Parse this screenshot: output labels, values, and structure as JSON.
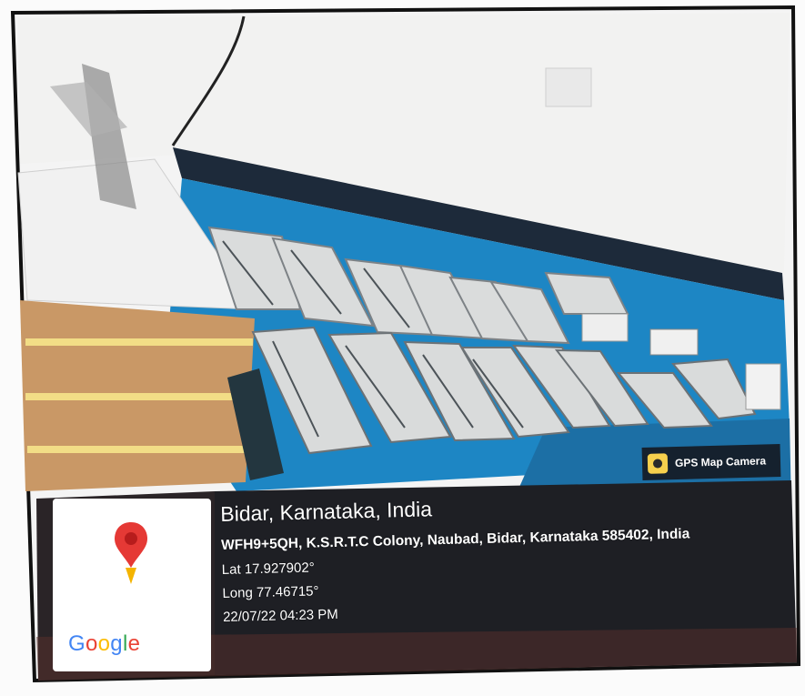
{
  "badge": {
    "label": "GPS Map Camera",
    "icon": "gps-map-camera-icon"
  },
  "map": {
    "pin_icon": "location-pin-icon",
    "brand": "Google",
    "pin_color": "#e53935"
  },
  "location": {
    "city": "Bidar, Karnataka, India",
    "address": "WFH9+5QH, K.S.R.T.C Colony, Naubad, Bidar, Karnataka 585402, India",
    "lat": "Lat 17.927902°",
    "long": "Long 77.46715°",
    "timestamp": "22/07/22 04:23 PM"
  }
}
